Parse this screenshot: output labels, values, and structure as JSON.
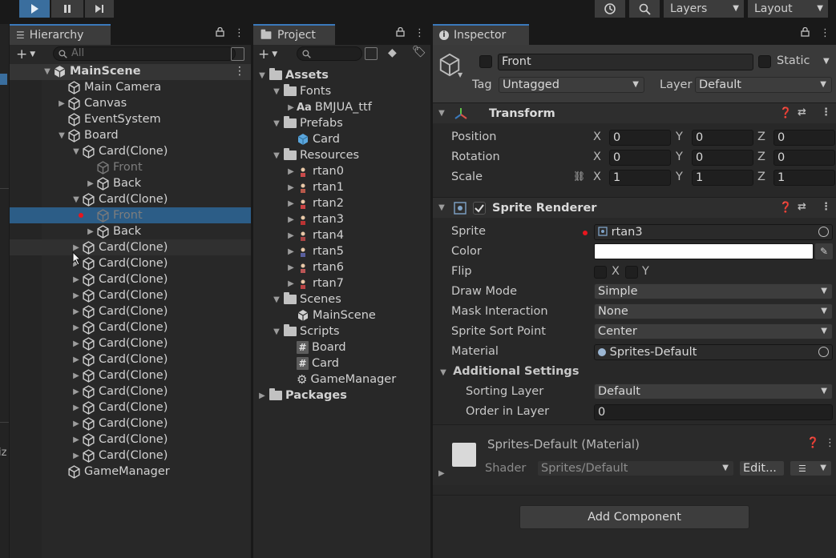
{
  "toolbar": {
    "play_icon": "play-icon",
    "pause_icon": "pause-icon",
    "step_icon": "step-icon",
    "layers_label": "Layers",
    "layout_label": "Layout"
  },
  "hierarchy": {
    "tab_label": "Hierarchy",
    "search_placeholder": "All",
    "scene_name": "MainScene",
    "items": [
      {
        "label": "Main Camera",
        "depth": 1,
        "expander": "",
        "icon": "cube",
        "dim": false
      },
      {
        "label": "Canvas",
        "depth": 1,
        "expander": "closed",
        "icon": "cube",
        "dim": false
      },
      {
        "label": "EventSystem",
        "depth": 1,
        "expander": "",
        "icon": "cube",
        "dim": false
      },
      {
        "label": "Board",
        "depth": 1,
        "expander": "open",
        "icon": "cube",
        "dim": false
      },
      {
        "label": "Card(Clone)",
        "depth": 2,
        "expander": "open",
        "icon": "cube",
        "dim": false
      },
      {
        "label": "Front",
        "depth": 3,
        "expander": "",
        "icon": "cube",
        "dim": true
      },
      {
        "label": "Back",
        "depth": 3,
        "expander": "closed",
        "icon": "cube",
        "dim": false
      },
      {
        "label": "Card(Clone)",
        "depth": 2,
        "expander": "open",
        "icon": "cube",
        "dim": false
      },
      {
        "label": "Front",
        "depth": 3,
        "expander": "",
        "icon": "cube",
        "dim": true,
        "selected": true,
        "marker": true
      },
      {
        "label": "Back",
        "depth": 3,
        "expander": "closed",
        "icon": "cube",
        "dim": false
      },
      {
        "label": "Card(Clone)",
        "depth": 2,
        "expander": "closed",
        "icon": "cube",
        "dim": false,
        "hover": true
      },
      {
        "label": "Card(Clone)",
        "depth": 2,
        "expander": "closed",
        "icon": "cube",
        "dim": false
      },
      {
        "label": "Card(Clone)",
        "depth": 2,
        "expander": "closed",
        "icon": "cube",
        "dim": false
      },
      {
        "label": "Card(Clone)",
        "depth": 2,
        "expander": "closed",
        "icon": "cube",
        "dim": false
      },
      {
        "label": "Card(Clone)",
        "depth": 2,
        "expander": "closed",
        "icon": "cube",
        "dim": false
      },
      {
        "label": "Card(Clone)",
        "depth": 2,
        "expander": "closed",
        "icon": "cube",
        "dim": false
      },
      {
        "label": "Card(Clone)",
        "depth": 2,
        "expander": "closed",
        "icon": "cube",
        "dim": false
      },
      {
        "label": "Card(Clone)",
        "depth": 2,
        "expander": "closed",
        "icon": "cube",
        "dim": false
      },
      {
        "label": "Card(Clone)",
        "depth": 2,
        "expander": "closed",
        "icon": "cube",
        "dim": false
      },
      {
        "label": "Card(Clone)",
        "depth": 2,
        "expander": "closed",
        "icon": "cube",
        "dim": false
      },
      {
        "label": "Card(Clone)",
        "depth": 2,
        "expander": "closed",
        "icon": "cube",
        "dim": false
      },
      {
        "label": "Card(Clone)",
        "depth": 2,
        "expander": "closed",
        "icon": "cube",
        "dim": false
      },
      {
        "label": "Card(Clone)",
        "depth": 2,
        "expander": "closed",
        "icon": "cube",
        "dim": false
      },
      {
        "label": "Card(Clone)",
        "depth": 2,
        "expander": "closed",
        "icon": "cube",
        "dim": false
      },
      {
        "label": "GameManager",
        "depth": 1,
        "expander": "",
        "icon": "cube",
        "dim": false
      }
    ],
    "left_edge_text": "iz"
  },
  "project": {
    "tab_label": "Project",
    "items": [
      {
        "label": "Assets",
        "depth": 0,
        "expander": "open",
        "icon": "folder",
        "bold": true
      },
      {
        "label": "Fonts",
        "depth": 1,
        "expander": "open",
        "icon": "folder"
      },
      {
        "label": "BMJUA_ttf",
        "depth": 2,
        "expander": "closed",
        "icon": "font",
        "font_icon_text": "Aa"
      },
      {
        "label": "Prefabs",
        "depth": 1,
        "expander": "open",
        "icon": "folder"
      },
      {
        "label": "Card",
        "depth": 2,
        "expander": "",
        "icon": "prefab"
      },
      {
        "label": "Resources",
        "depth": 1,
        "expander": "open",
        "icon": "folder"
      },
      {
        "label": "rtan0",
        "depth": 2,
        "expander": "closed",
        "icon": "sprite"
      },
      {
        "label": "rtan1",
        "depth": 2,
        "expander": "closed",
        "icon": "sprite"
      },
      {
        "label": "rtan2",
        "depth": 2,
        "expander": "closed",
        "icon": "sprite"
      },
      {
        "label": "rtan3",
        "depth": 2,
        "expander": "closed",
        "icon": "sprite"
      },
      {
        "label": "rtan4",
        "depth": 2,
        "expander": "closed",
        "icon": "sprite"
      },
      {
        "label": "rtan5",
        "depth": 2,
        "expander": "closed",
        "icon": "sprite"
      },
      {
        "label": "rtan6",
        "depth": 2,
        "expander": "closed",
        "icon": "sprite"
      },
      {
        "label": "rtan7",
        "depth": 2,
        "expander": "closed",
        "icon": "sprite"
      },
      {
        "label": "Scenes",
        "depth": 1,
        "expander": "open",
        "icon": "folder"
      },
      {
        "label": "MainScene",
        "depth": 2,
        "expander": "",
        "icon": "scene"
      },
      {
        "label": "Scripts",
        "depth": 1,
        "expander": "open",
        "icon": "folder"
      },
      {
        "label": "Board",
        "depth": 2,
        "expander": "",
        "icon": "script",
        "script_icon_text": "#"
      },
      {
        "label": "Card",
        "depth": 2,
        "expander": "",
        "icon": "script",
        "script_icon_text": "#"
      },
      {
        "label": "GameManager",
        "depth": 2,
        "expander": "",
        "icon": "gear"
      },
      {
        "label": "Packages",
        "depth": 0,
        "expander": "closed",
        "icon": "folder",
        "bold": true
      }
    ]
  },
  "inspector": {
    "tab_label": "Inspector",
    "object_name": "Front",
    "static_label": "Static",
    "tag_label": "Tag",
    "tag_value": "Untagged",
    "layer_label": "Layer",
    "layer_value": "Default",
    "transform": {
      "title": "Transform",
      "rows": [
        {
          "label": "Position",
          "x": "0",
          "y": "0",
          "z": "0"
        },
        {
          "label": "Rotation",
          "x": "0",
          "y": "0",
          "z": "0"
        },
        {
          "label": "Scale",
          "x": "1",
          "y": "1",
          "z": "1"
        }
      ],
      "axis_x": "X",
      "axis_y": "Y",
      "axis_z": "Z"
    },
    "sprite_renderer": {
      "title": "Sprite Renderer",
      "sprite_label": "Sprite",
      "sprite_value": "rtan3",
      "color_label": "Color",
      "color_value": "#ffffff",
      "flip_label": "Flip",
      "flip_x": "X",
      "flip_y": "Y",
      "draw_mode_label": "Draw Mode",
      "draw_mode_value": "Simple",
      "mask_label": "Mask Interaction",
      "mask_value": "None",
      "sort_point_label": "Sprite Sort Point",
      "sort_point_value": "Center",
      "material_label": "Material",
      "material_value": "Sprites-Default",
      "additional_label": "Additional Settings",
      "sorting_layer_label": "Sorting Layer",
      "sorting_layer_value": "Default",
      "order_label": "Order in Layer",
      "order_value": "0"
    },
    "material": {
      "title": "Sprites-Default (Material)",
      "shader_label": "Shader",
      "shader_value": "Sprites/Default",
      "edit_label": "Edit...",
      "swatch_color": "#d9d9d9"
    },
    "add_component_label": "Add Component"
  },
  "colors": {
    "selection": "#2c5d87",
    "accent": "#3a79bb",
    "marker_red": "#e8161e"
  }
}
